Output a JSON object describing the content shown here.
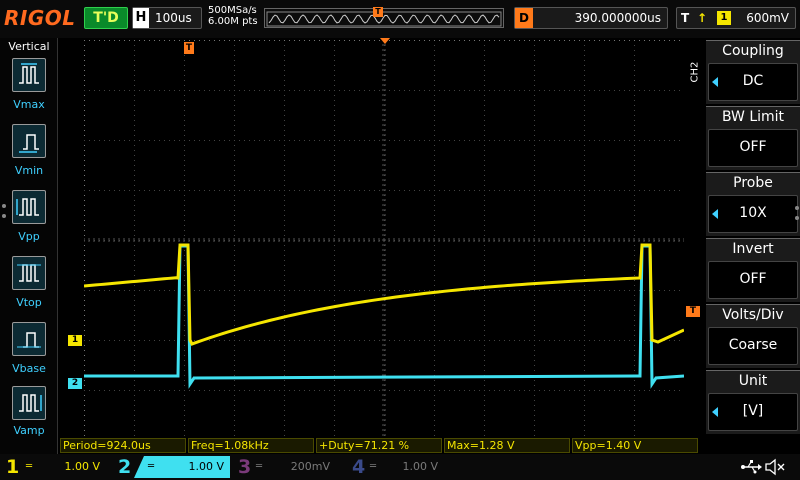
{
  "header": {
    "brand": "RIGOL",
    "run_status": "T'D",
    "timebase_letter": "H",
    "timebase": "100us",
    "sample_rate": "500MSa/s",
    "memory_depth": "6.00M pts",
    "memory_trigger_marker": "T",
    "delay_letter": "D",
    "delay": "390.000000us",
    "trigger_letter": "T",
    "trigger_edge": "↑",
    "trigger_source": "1",
    "trigger_level": "600mV"
  },
  "left_panel": {
    "title": "Vertical",
    "items": [
      {
        "label": "Vmax",
        "icon": "vmax-icon"
      },
      {
        "label": "Vmin",
        "icon": "vmin-icon"
      },
      {
        "label": "Vpp",
        "icon": "vpp-icon"
      },
      {
        "label": "Vtop",
        "icon": "vtop-icon"
      },
      {
        "label": "Vbase",
        "icon": "vbase-icon"
      },
      {
        "label": "Vamp",
        "icon": "vamp-icon"
      }
    ]
  },
  "right_menu": {
    "channel_tag": "CH2",
    "items": [
      {
        "title": "Coupling",
        "value": "DC",
        "has_arrow": true
      },
      {
        "title": "BW Limit",
        "value": "OFF",
        "has_arrow": false
      },
      {
        "title": "Probe",
        "value": "10X",
        "has_arrow": true
      },
      {
        "title": "Invert",
        "value": "OFF",
        "has_arrow": false
      },
      {
        "title": "Volts/Div",
        "value": "Coarse",
        "has_arrow": false
      },
      {
        "title": "Unit",
        "value": "[V]",
        "has_arrow": true
      }
    ]
  },
  "markers": {
    "trigger_pos": "T",
    "ch1": "1",
    "ch2": "2",
    "trigger_level": "T"
  },
  "measurements": [
    "Period=924.0us",
    "Freq=1.08kHz",
    "+Duty=71.21 %",
    "Max=1.28 V",
    "Vpp=1.40 V"
  ],
  "channels": [
    {
      "num": "1",
      "coupling": "═",
      "scale": "1.00 V",
      "color": "#f5e600",
      "active": false
    },
    {
      "num": "2",
      "coupling": "═",
      "scale": "1.00 V",
      "color": "#3fe0f0",
      "active": true
    },
    {
      "num": "3",
      "coupling": "═",
      "scale": "200mV",
      "color": "#c040c0",
      "active": false
    },
    {
      "num": "4",
      "coupling": "═",
      "scale": "1.00 V",
      "color": "#4a6cff",
      "active": false
    }
  ],
  "colors": {
    "ch1": "#f5e600",
    "ch2": "#3fe0f0",
    "ch3": "#c040c0",
    "ch4": "#4a6cff",
    "trigger": "#ff7a1a",
    "accent": "#3fd0ff"
  },
  "icons": {
    "usb": "usb-icon",
    "mute": "mute-icon"
  }
}
